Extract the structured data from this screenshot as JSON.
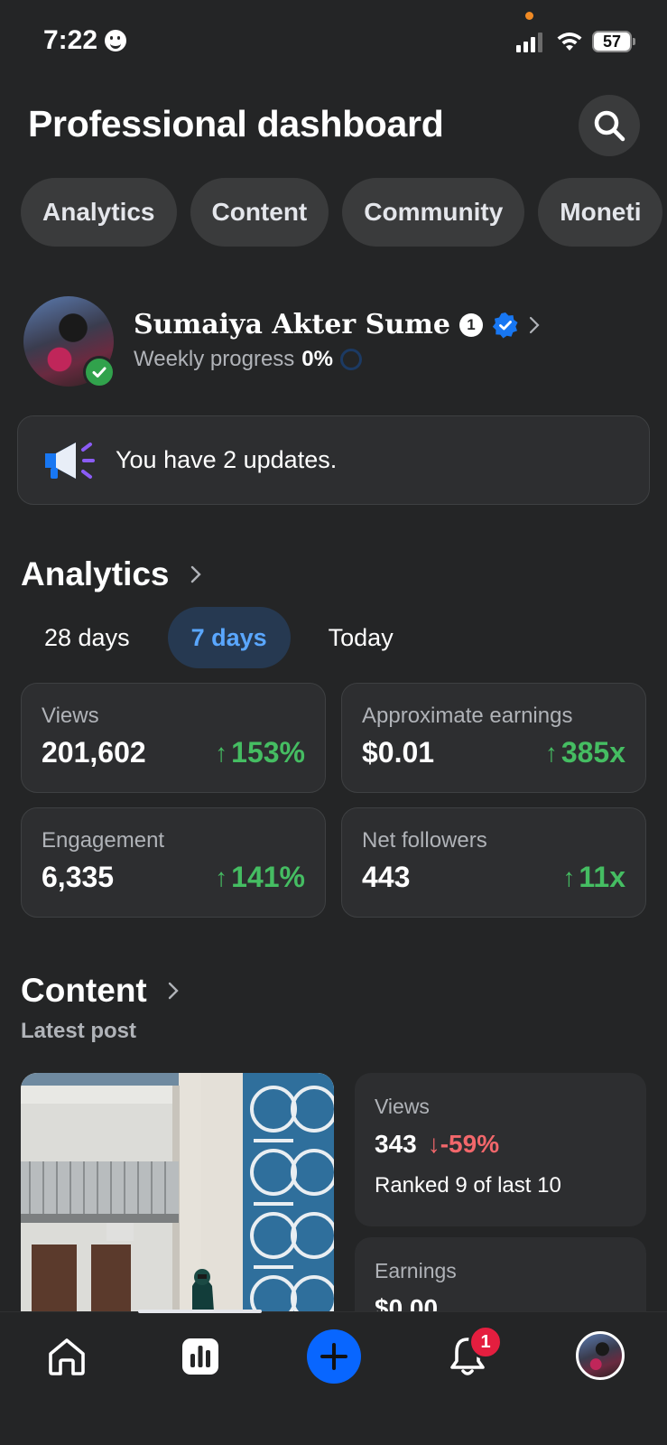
{
  "status_bar": {
    "time": "7:22",
    "battery": "57"
  },
  "header": {
    "title": "Professional dashboard"
  },
  "chips": [
    {
      "label": "Analytics"
    },
    {
      "label": "Content"
    },
    {
      "label": "Community"
    },
    {
      "label": "Moneti"
    }
  ],
  "profile": {
    "name": "Sumaiya Akter Sume",
    "badge_number": "1",
    "progress_label": "Weekly progress",
    "progress_value": "0%"
  },
  "updates": {
    "text": "You have 2 updates."
  },
  "analytics": {
    "heading": "Analytics",
    "periods": [
      {
        "label": "28 days"
      },
      {
        "label": "7 days"
      },
      {
        "label": "Today"
      }
    ],
    "selected_period": "7 days",
    "cards": [
      {
        "label": "Views",
        "value": "201,602",
        "delta": "153%"
      },
      {
        "label": "Approximate earnings",
        "value": "$0.01",
        "delta": "385x"
      },
      {
        "label": "Engagement",
        "value": "6,335",
        "delta": "141%"
      },
      {
        "label": "Net followers",
        "value": "443",
        "delta": "11x"
      }
    ]
  },
  "content": {
    "heading": "Content",
    "subheading": "Latest post",
    "views_label": "Views",
    "views_value": "343",
    "views_delta": "-59%",
    "rank_text": "Ranked 9 of last 10",
    "earnings_label": "Earnings",
    "earnings_value": "$0.00"
  },
  "tab_bar": {
    "notification_count": "1"
  },
  "colors": {
    "background": "#242526",
    "card": "#2d2e30",
    "accent_blue": "#0866ff",
    "positive_green": "#45bd62",
    "negative_red": "#f2676b"
  }
}
